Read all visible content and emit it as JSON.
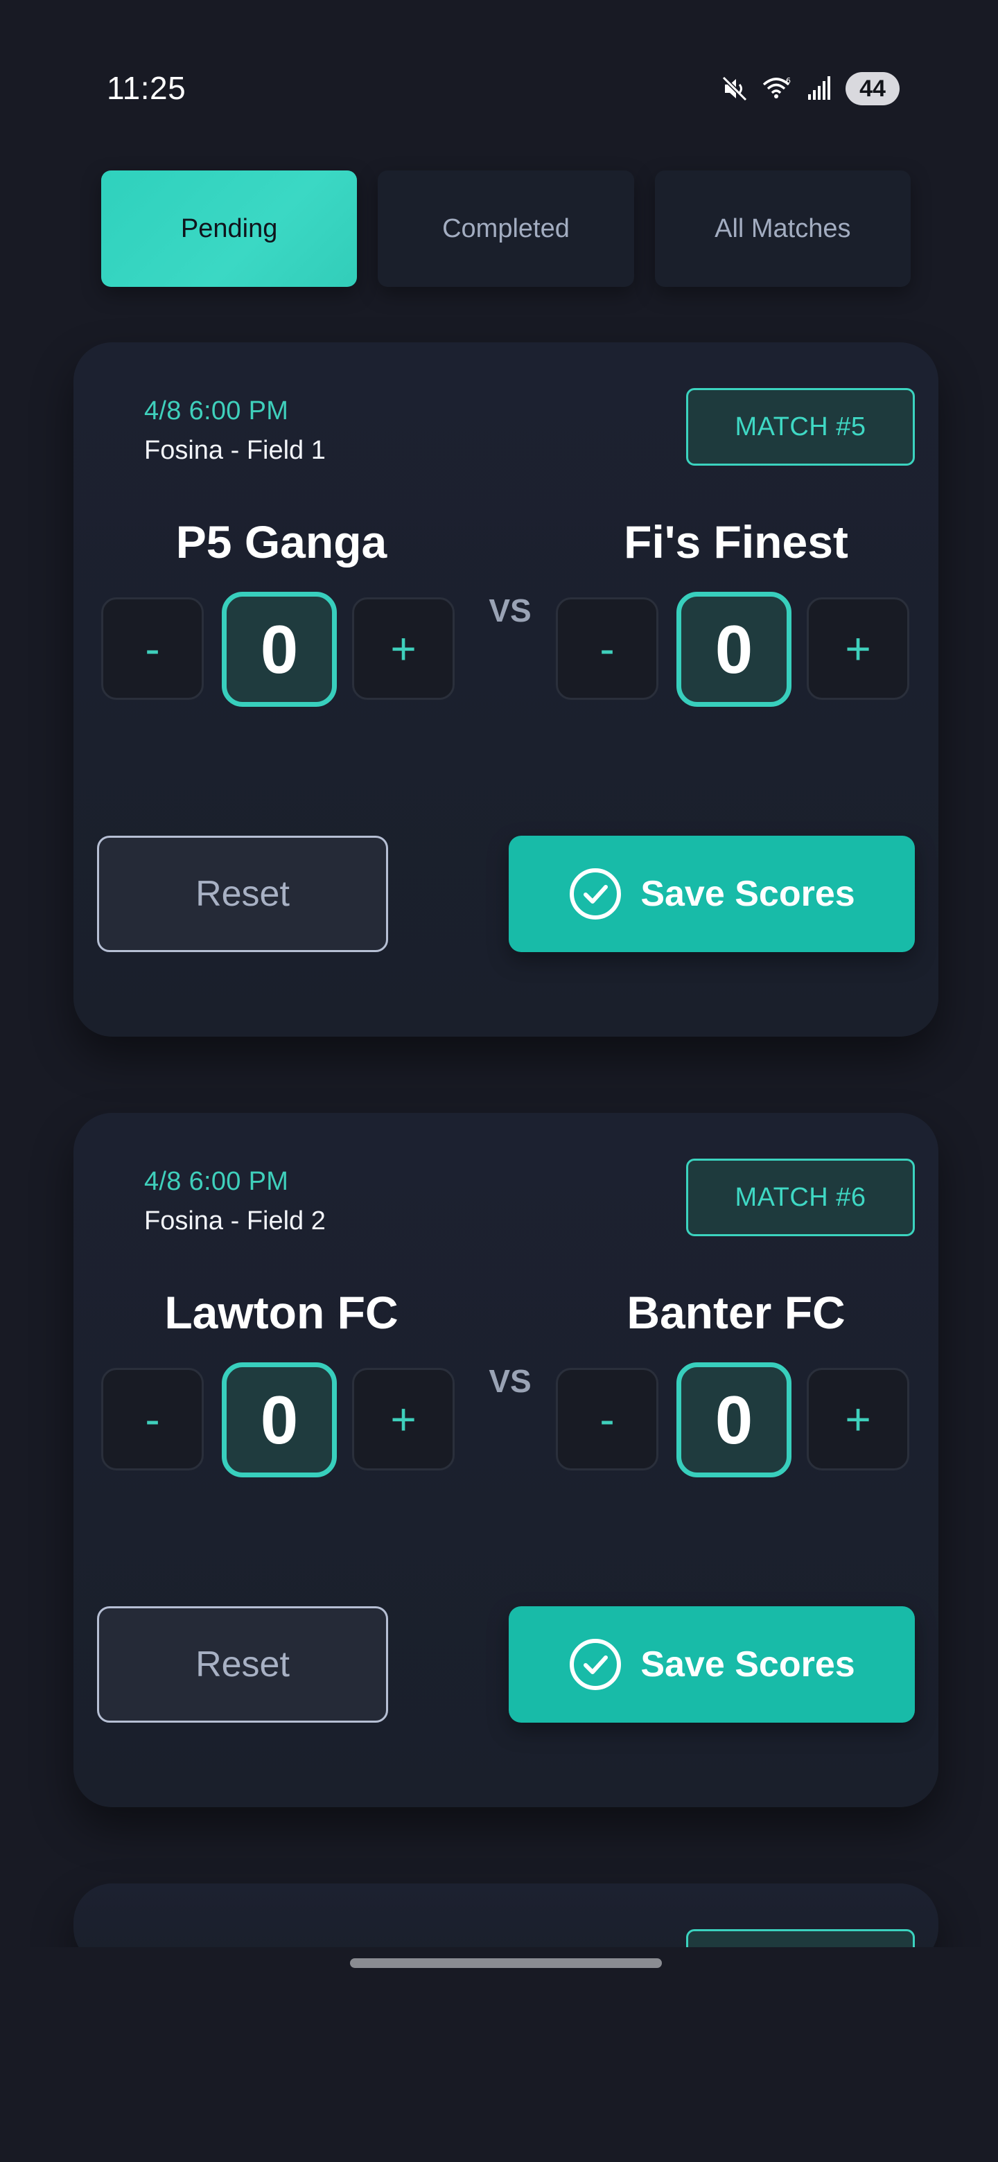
{
  "status_bar": {
    "time": "11:25",
    "battery": "44",
    "icons": [
      "mute-icon",
      "wifi-icon",
      "signal-icon",
      "battery-icon"
    ]
  },
  "tabs": [
    {
      "label": "Pending",
      "active": true
    },
    {
      "label": "Completed",
      "active": false
    },
    {
      "label": "All Matches",
      "active": false
    }
  ],
  "matches": [
    {
      "datetime": "4/8 6:00 PM",
      "venue": "Fosina - Field 1",
      "badge": "MATCH #5",
      "home": {
        "name": "P5 Ganga",
        "score": "0"
      },
      "away": {
        "name": "Fi's Finest",
        "score": "0"
      },
      "vs": "VS",
      "minus_label": "-",
      "plus_label": "+",
      "reset_label": "Reset",
      "save_label": "Save Scores"
    },
    {
      "datetime": "4/8 6:00 PM",
      "venue": "Fosina - Field 2",
      "badge": "MATCH #6",
      "home": {
        "name": "Lawton FC",
        "score": "0"
      },
      "away": {
        "name": "Banter FC",
        "score": "0"
      },
      "vs": "VS",
      "minus_label": "-",
      "plus_label": "+",
      "reset_label": "Reset",
      "save_label": "Save Scores"
    }
  ],
  "colors": {
    "background": "#181a24",
    "card": "#1c2130",
    "accent": "#3bd3bf",
    "save_button": "#18bba8"
  }
}
